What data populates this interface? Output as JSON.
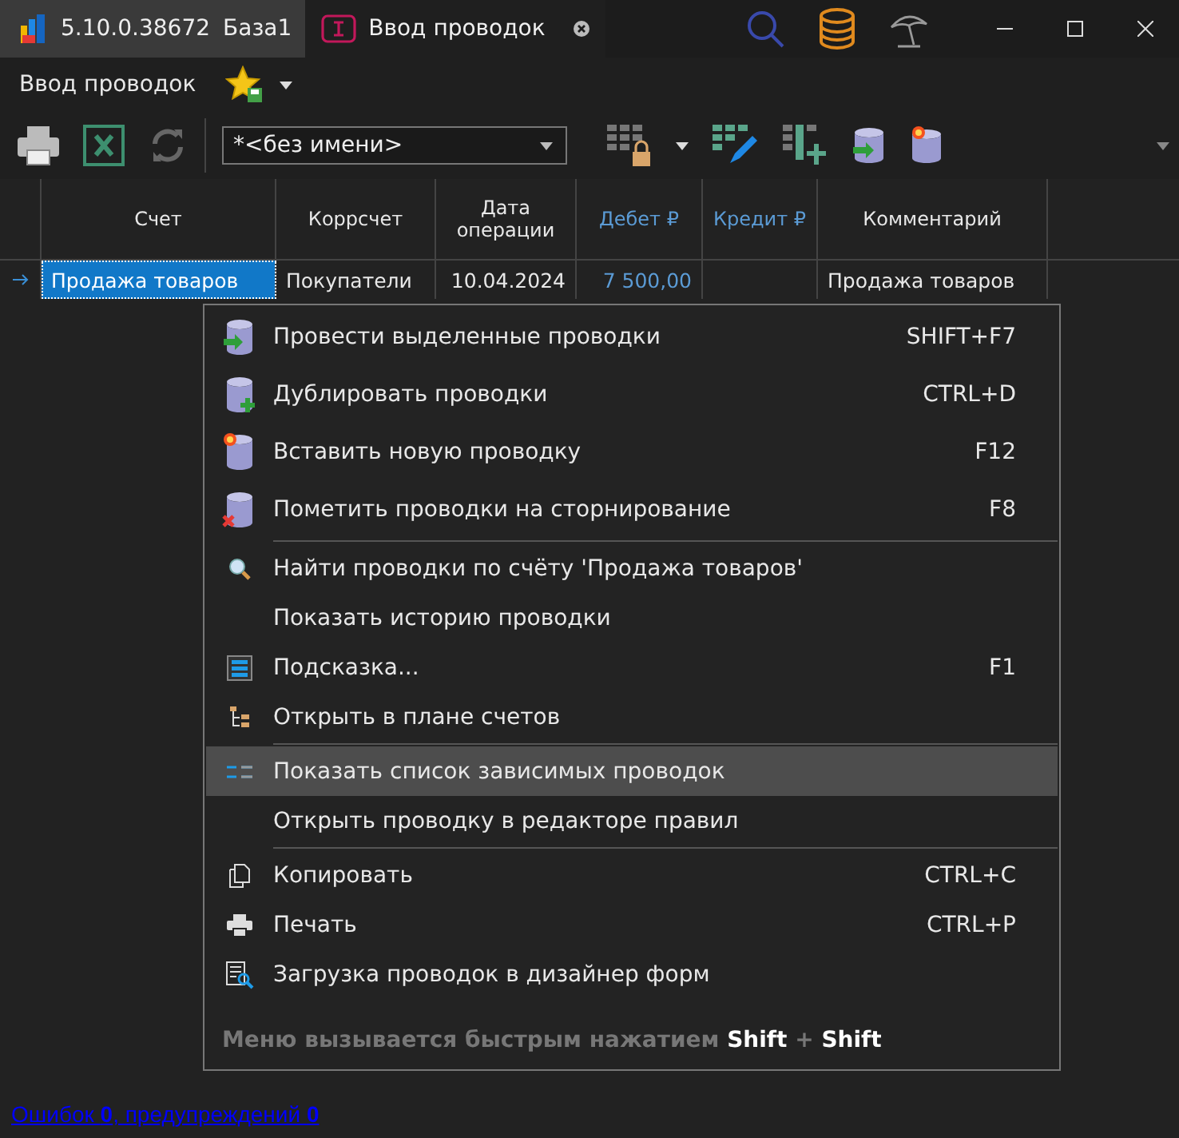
{
  "title_bar": {
    "version": "5.10.0.38672",
    "database": "База1",
    "tab": {
      "title": "Ввод проводок",
      "selected": true
    }
  },
  "header": {
    "title": "Ввод проводок"
  },
  "toolbar": {
    "layout_select": {
      "value": "*<без имени>"
    }
  },
  "table": {
    "columns": [
      {
        "label": "Счет",
        "accent": false
      },
      {
        "label": "Коррсчет",
        "accent": false
      },
      {
        "label": "Дата операции",
        "accent": false
      },
      {
        "label": "Дебет ₽",
        "accent": true
      },
      {
        "label": "Кредит ₽",
        "accent": true
      },
      {
        "label": "Комментарий",
        "accent": false
      }
    ],
    "rows": [
      {
        "current": true,
        "cells": [
          "Продажа товаров",
          "Покупатели",
          "10.04.2024",
          "7 500,00",
          "",
          "Продажа товаров"
        ]
      }
    ]
  },
  "context_menu": {
    "items": [
      {
        "kind": "post",
        "label": "Провести выделенные проводки",
        "shortcut": "SHIFT+F7",
        "separator_before": false,
        "selected": false
      },
      {
        "kind": "duplicate",
        "label": "Дублировать проводки",
        "shortcut": "CTRL+D",
        "separator_before": false,
        "selected": false
      },
      {
        "kind": "insert",
        "label": "Вставить новую проводку",
        "shortcut": "F12",
        "separator_before": false,
        "selected": false
      },
      {
        "kind": "storno",
        "label": "Пометить проводки на сторнирование",
        "shortcut": "F8",
        "separator_before": false,
        "selected": false
      },
      {
        "kind": "search",
        "label": "Найти проводки по счёту 'Продажа товаров'",
        "separator_before": true,
        "selected": false
      },
      {
        "kind": "none",
        "label": "Показать историю проводки",
        "separator_before": false,
        "selected": false
      },
      {
        "kind": "hint",
        "label": "Подсказка...",
        "shortcut": "F1",
        "separator_before": false,
        "selected": false
      },
      {
        "kind": "tree",
        "label": "Открыть в плане счетов",
        "separator_before": false,
        "selected": false
      },
      {
        "kind": "deps",
        "label": "Показать список зависимых проводок",
        "separator_before": true,
        "selected": true
      },
      {
        "kind": "none",
        "label": "Открыть проводку в редакторе правил",
        "separator_before": false,
        "selected": false
      },
      {
        "kind": "copy",
        "label": "Копировать",
        "shortcut": "CTRL+C",
        "separator_before": true,
        "selected": false
      },
      {
        "kind": "print",
        "label": "Печать",
        "shortcut": "CTRL+P",
        "separator_before": false,
        "selected": false
      },
      {
        "kind": "designer",
        "label": "Загрузка проводок в дизайнер форм",
        "separator_before": false,
        "selected": false
      }
    ],
    "hint": "Меню вызывается быстрым нажатием **Shift** + **Shift**"
  },
  "status": {
    "link": "Ошибок **0**, предупреждений **0**"
  }
}
